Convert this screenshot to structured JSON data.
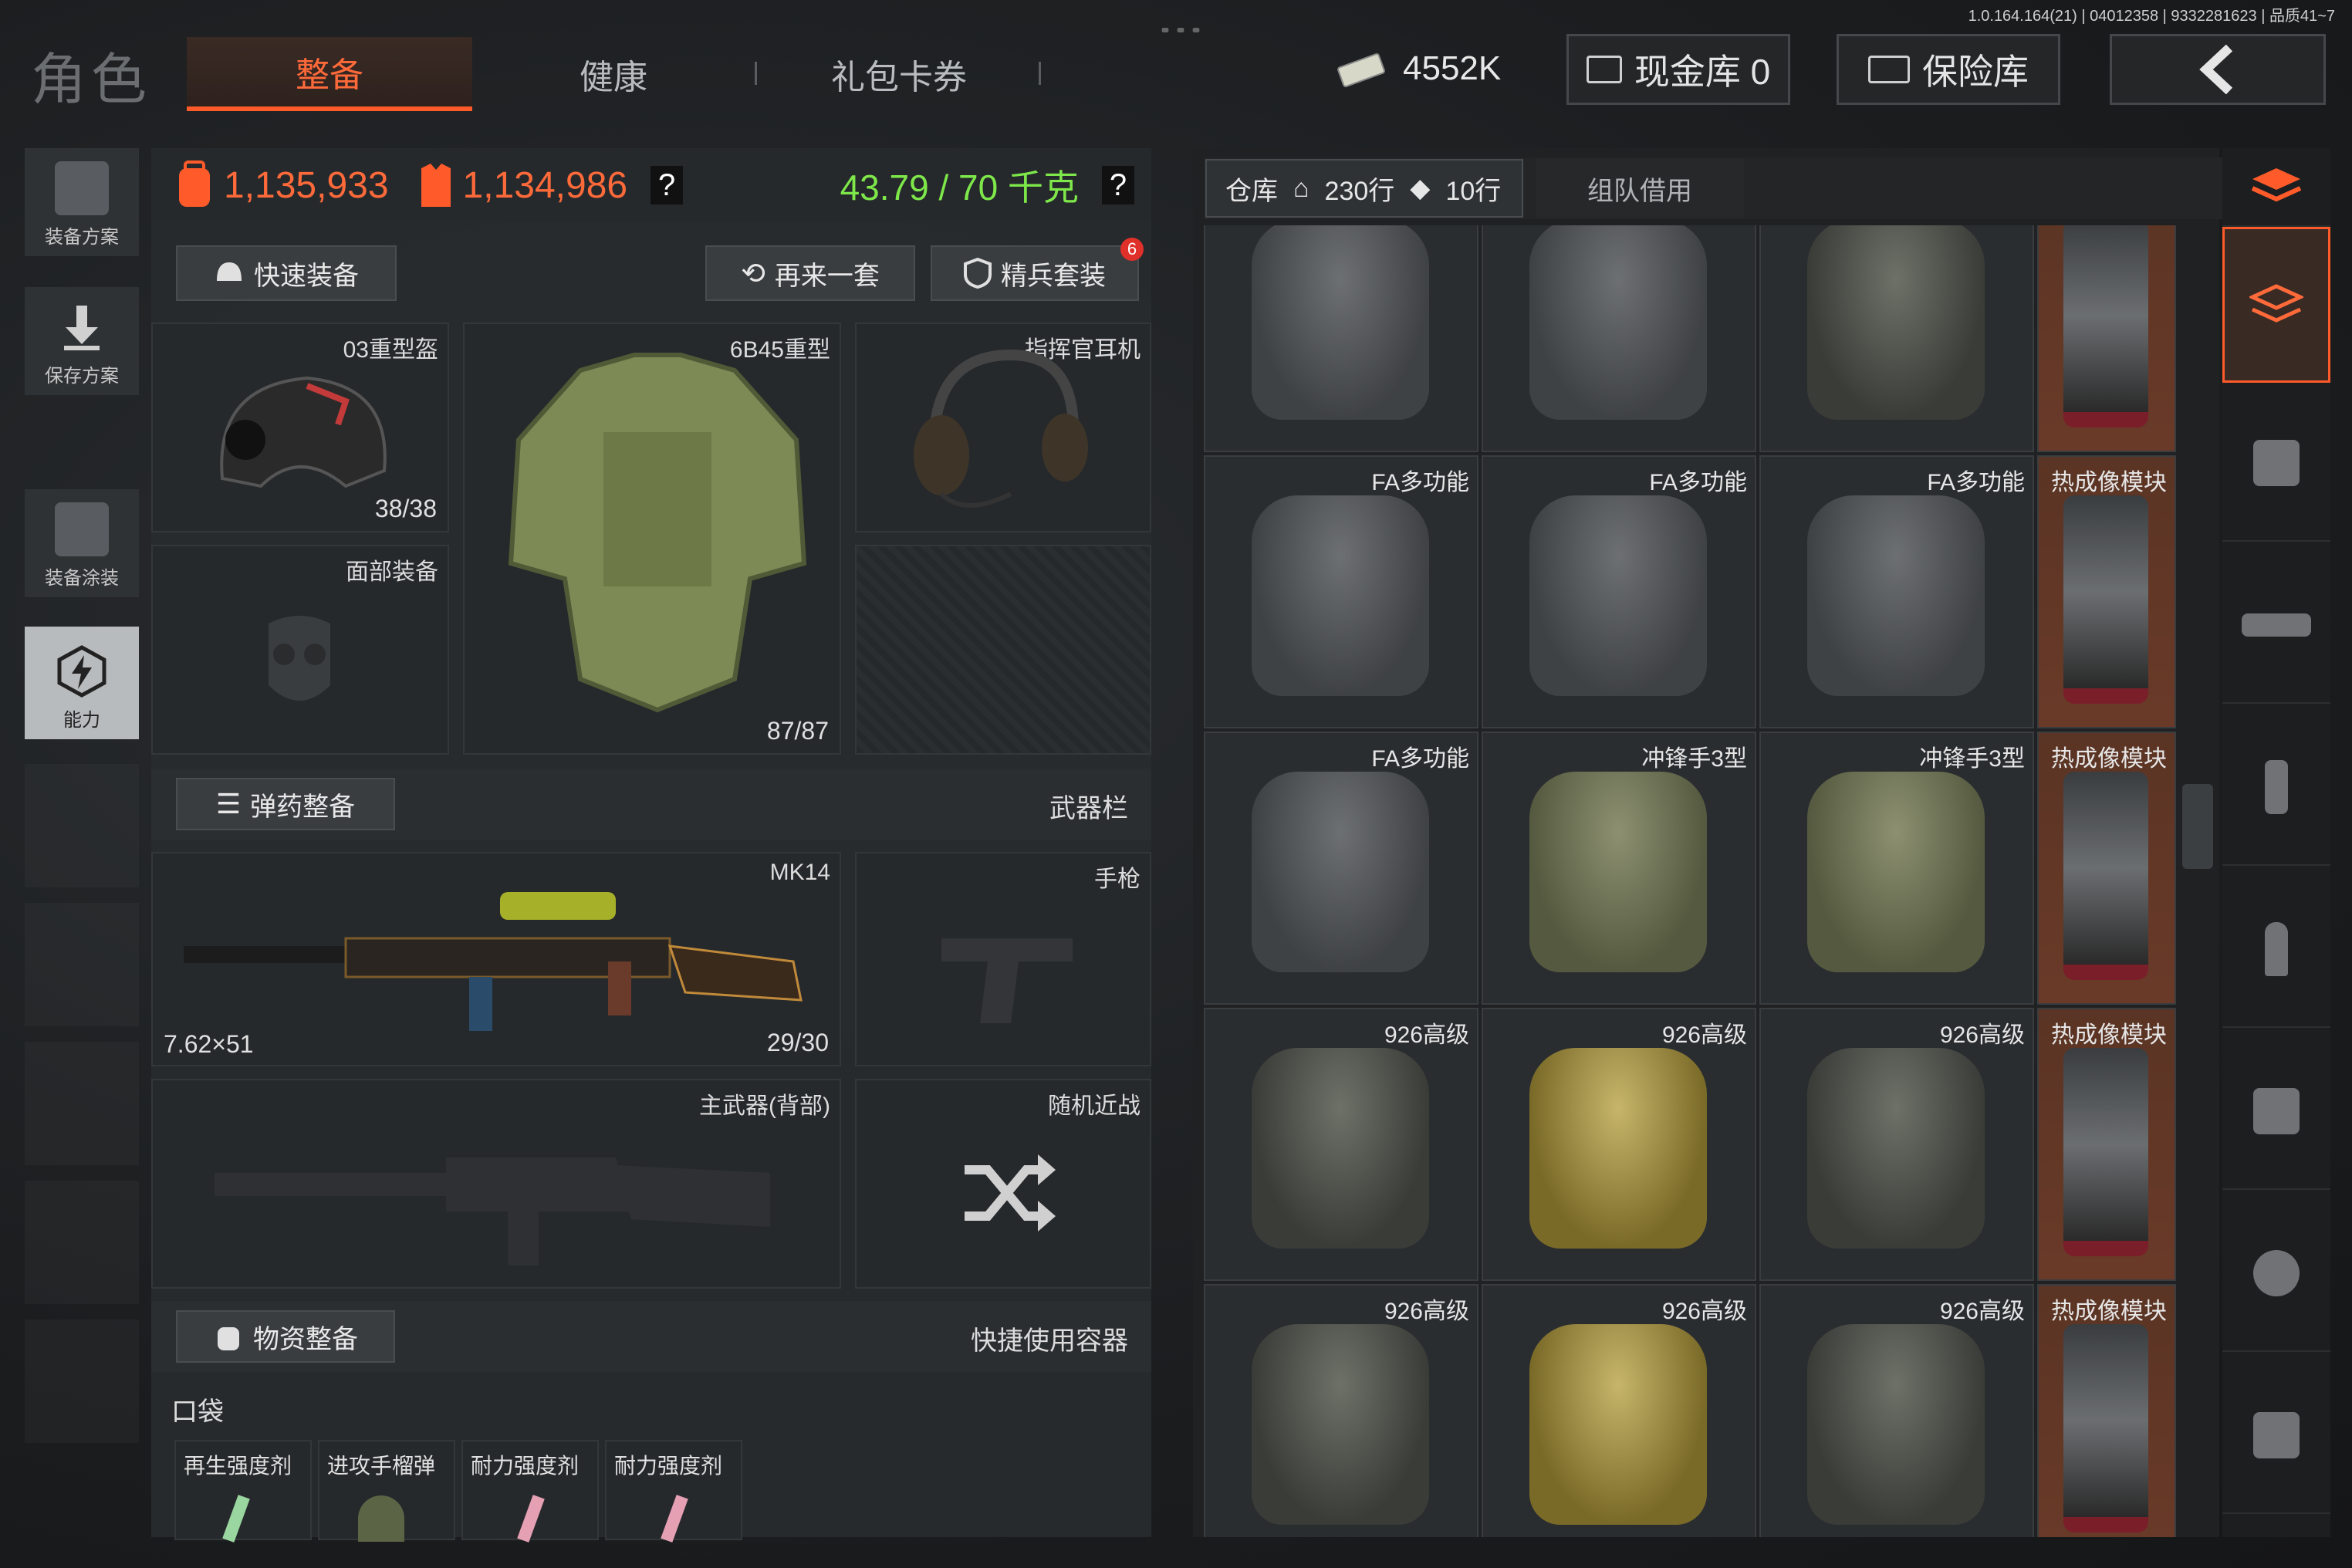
{
  "version_info": "1.0.164.164(21) | 04012358 | 9332281623 | 品质41~7",
  "header": {
    "title": "角色",
    "tabs": [
      "整备",
      "健康",
      "礼包卡券"
    ],
    "active_tab": "整备",
    "money": "4552K",
    "cash_vault": "现金库 0",
    "safe_vault": "保险库"
  },
  "sidebar": {
    "items": [
      "装备方案",
      "保存方案",
      "装备涂装",
      "能力"
    ]
  },
  "stats": {
    "value_a": "1,135,933",
    "value_b": "1,134,986",
    "weight": "43.79 / 70 千克"
  },
  "actions": {
    "quick_equip": "快速装备",
    "repeat": "再来一套",
    "elite_kit": "精兵套装",
    "elite_badge": "6"
  },
  "gear": {
    "helmet": {
      "name": "03重型盔",
      "count": "38/38"
    },
    "armor": {
      "name": "6B45重型",
      "count": "87/87"
    },
    "headset": {
      "name": "指挥官耳机"
    },
    "face": {
      "name": "面部装备"
    }
  },
  "ammo_section": {
    "title": "弹药整备",
    "right_label": "武器栏"
  },
  "weapons": {
    "primary": {
      "name": "MK14",
      "caliber": "7.62×51",
      "ammo": "29/30"
    },
    "pistol": "手枪",
    "back": "主武器(背部)",
    "melee": "随机近战"
  },
  "supply_section": {
    "title": "物资整备",
    "right_label": "快捷使用容器"
  },
  "pocket": {
    "title": "口袋",
    "items": [
      "再生强度剂",
      "进攻手榴弹",
      "耐力强度剂",
      "耐力强度剂"
    ]
  },
  "warehouse": {
    "tab_label": "仓库",
    "rows_a": "230行",
    "rows_b": "10行",
    "team_tab": "组队借用",
    "rows": [
      [
        "",
        "",
        "",
        ""
      ],
      [
        "FA多功能",
        "FA多功能",
        "FA多功能",
        "热成像模块"
      ],
      [
        "FA多功能",
        "冲锋手3型",
        "冲锋手3型",
        "热成像模块"
      ],
      [
        "926高级",
        "926高级",
        "926高级",
        "热成像模块"
      ],
      [
        "926高级",
        "926高级",
        "926高级",
        "热成像模块"
      ]
    ]
  },
  "colors": {
    "accent": "#ff5b2a",
    "value_orange": "#ff6a3a",
    "weight_green": "#7ee84a",
    "badge_red": "#e0302a"
  },
  "categories": [
    "stack-icon",
    "backpack-icon",
    "helmet-icon",
    "rifle-icon",
    "magazine-icon",
    "bullet-icon",
    "armor-icon",
    "grenade-icon",
    "container-icon"
  ]
}
